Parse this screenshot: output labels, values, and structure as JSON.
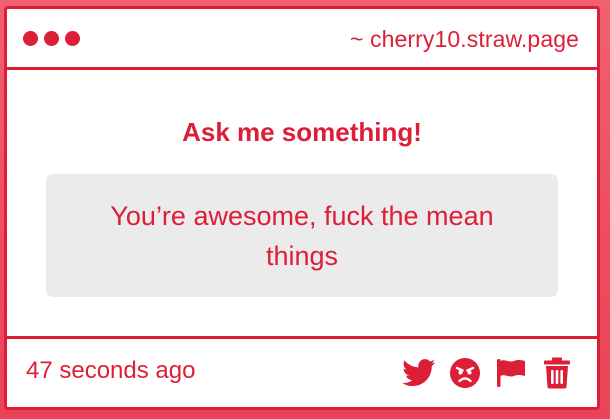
{
  "window": {
    "url_label": "~ cherry10.straw.page"
  },
  "question": {
    "prompt": "Ask me something!",
    "message": "You’re awesome, fuck the mean things"
  },
  "footer": {
    "timestamp": "47 seconds ago",
    "actions": [
      {
        "icon": "twitter-icon"
      },
      {
        "icon": "angry-face-icon"
      },
      {
        "icon": "flag-icon"
      },
      {
        "icon": "trash-icon"
      }
    ]
  },
  "colors": {
    "accent": "#dd1e37",
    "background": "#ee4d5f",
    "card": "#ffffff",
    "message_box": "#ecebec"
  }
}
